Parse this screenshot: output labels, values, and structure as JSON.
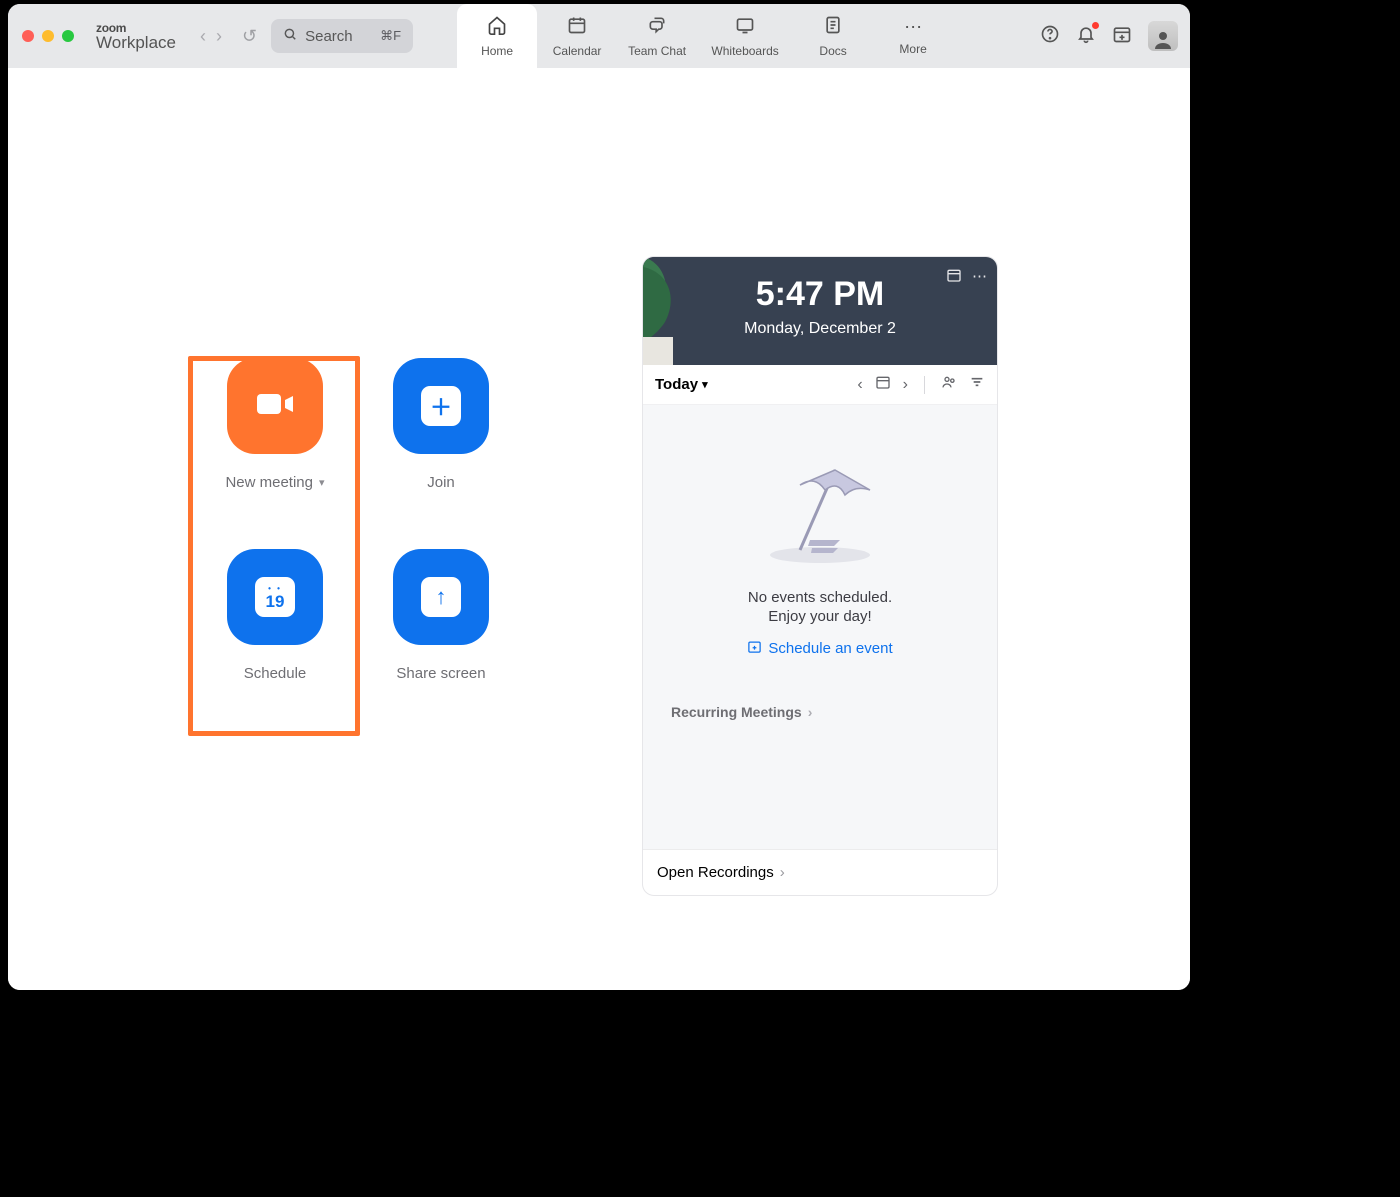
{
  "brand": {
    "line1": "zoom",
    "line2": "Workplace"
  },
  "search": {
    "placeholder": "Search",
    "shortcut": "⌘F"
  },
  "tabs": {
    "home": "Home",
    "calendar": "Calendar",
    "teamchat": "Team Chat",
    "whiteboards": "Whiteboards",
    "docs": "Docs",
    "more": "More"
  },
  "actions": {
    "new_meeting": "New meeting",
    "join": "Join",
    "schedule": "Schedule",
    "schedule_day": "19",
    "share_screen": "Share screen"
  },
  "clock": {
    "time": "5:47 PM",
    "date": "Monday, December 2"
  },
  "agenda": {
    "today": "Today",
    "empty1": "No events scheduled.",
    "empty2": "Enjoy your day!",
    "schedule_event": "Schedule an event",
    "recurring": "Recurring Meetings",
    "open_recordings": "Open Recordings"
  }
}
